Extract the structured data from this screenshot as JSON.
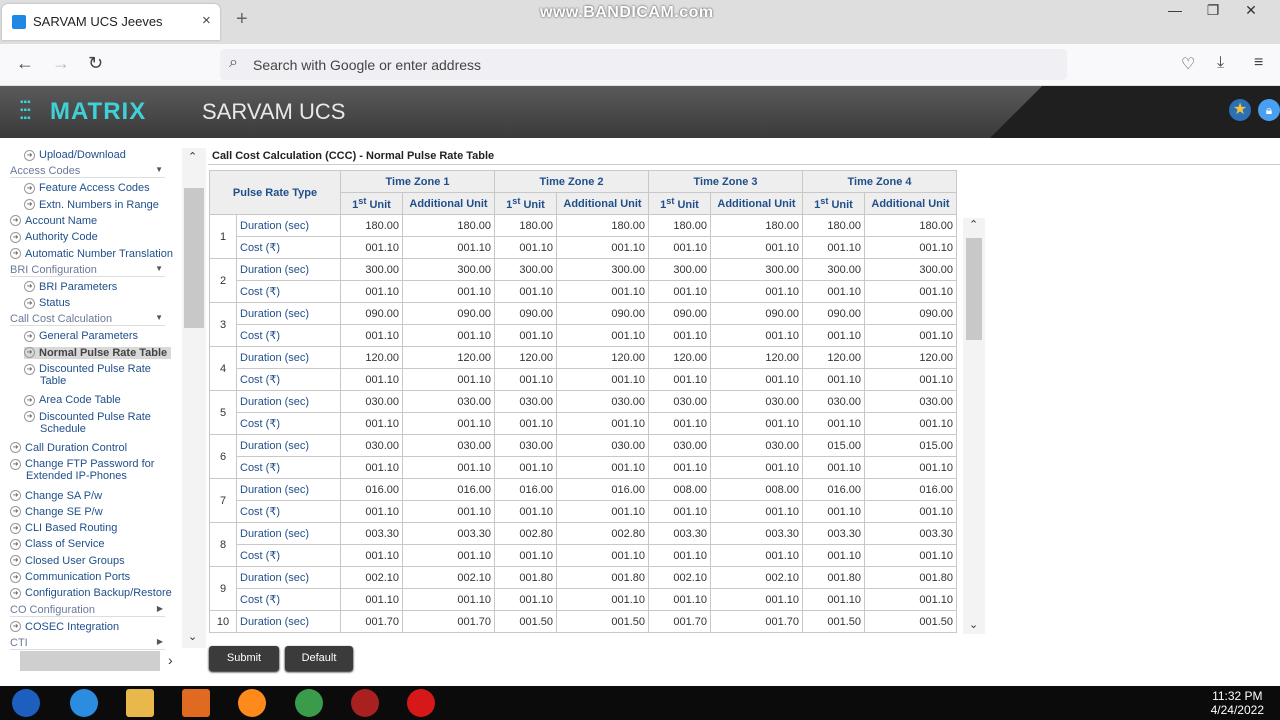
{
  "browser": {
    "tab_title": "SARVAM UCS Jeeves",
    "tab_close": "×",
    "new_tab": "+",
    "watermark": "www.BANDICAM.com",
    "url_placeholder": "Search with Google or enter address",
    "win_min": "—",
    "win_max": "❐",
    "win_close": "✕"
  },
  "app": {
    "logo_text": "MATRIX",
    "title": "SARVAM UCS"
  },
  "sidebar": {
    "items": [
      {
        "label": "Upload/Download",
        "type": "link",
        "indent": 2
      },
      {
        "label": "Access Codes",
        "type": "head"
      },
      {
        "label": "Feature Access Codes",
        "type": "link",
        "indent": 2
      },
      {
        "label": "Extn. Numbers in Range",
        "type": "link",
        "indent": 2
      },
      {
        "label": "Account Name",
        "type": "link",
        "indent": 1
      },
      {
        "label": "Authority Code",
        "type": "link",
        "indent": 1
      },
      {
        "label": "Automatic Number Translation",
        "type": "link",
        "indent": 1
      },
      {
        "label": "BRI Configuration",
        "type": "head"
      },
      {
        "label": "BRI Parameters",
        "type": "link",
        "indent": 2
      },
      {
        "label": "Status",
        "type": "link",
        "indent": 2
      },
      {
        "label": "Call Cost Calculation",
        "type": "head"
      },
      {
        "label": "General Parameters",
        "type": "link",
        "indent": 2
      },
      {
        "label": "Normal Pulse Rate Table",
        "type": "link",
        "indent": 2,
        "active": true
      },
      {
        "label": "Discounted Pulse Rate",
        "label2": "Table",
        "type": "link",
        "indent": 2
      },
      {
        "label": "Area Code Table",
        "type": "link",
        "indent": 2
      },
      {
        "label": "Discounted Pulse Rate",
        "label2": "Schedule",
        "type": "link",
        "indent": 2
      },
      {
        "label": "Call Duration Control",
        "type": "link",
        "indent": 1
      },
      {
        "label": "Change FTP Password for",
        "label2": "Extended IP-Phones",
        "type": "link",
        "indent": 1
      },
      {
        "label": "Change SA P/w",
        "type": "link",
        "indent": 1
      },
      {
        "label": "Change SE P/w",
        "type": "link",
        "indent": 1
      },
      {
        "label": "CLI Based Routing",
        "type": "link",
        "indent": 1
      },
      {
        "label": "Class of Service",
        "type": "link",
        "indent": 1
      },
      {
        "label": "Closed User Groups",
        "type": "link",
        "indent": 1
      },
      {
        "label": "Communication Ports",
        "type": "link",
        "indent": 1
      },
      {
        "label": "Configuration Backup/Restore",
        "type": "link",
        "indent": 1
      },
      {
        "label": "CO Configuration",
        "type": "head-closed"
      },
      {
        "label": "COSEC Integration",
        "type": "link",
        "indent": 1
      },
      {
        "label": "CTI",
        "type": "head-closed"
      }
    ]
  },
  "main": {
    "title": "Call Cost Calculation (CCC) - Normal Pulse Rate Table",
    "col_pulse": "Pulse Rate Type",
    "zones": [
      "Time Zone 1",
      "Time Zone 2",
      "Time Zone 3",
      "Time Zone 4"
    ],
    "unit_first_pre": "1",
    "unit_first_sup": "st",
    "unit_first_post": " Unit",
    "unit_additional": "Additional Unit",
    "label_duration": "Duration (sec)",
    "label_cost": "Cost (₹)",
    "rows": [
      {
        "n": "1",
        "dur": [
          "180.00",
          "180.00",
          "180.00",
          "180.00",
          "180.00",
          "180.00",
          "180.00",
          "180.00"
        ],
        "cost": [
          "001.10",
          "001.10",
          "001.10",
          "001.10",
          "001.10",
          "001.10",
          "001.10",
          "001.10"
        ]
      },
      {
        "n": "2",
        "dur": [
          "300.00",
          "300.00",
          "300.00",
          "300.00",
          "300.00",
          "300.00",
          "300.00",
          "300.00"
        ],
        "cost": [
          "001.10",
          "001.10",
          "001.10",
          "001.10",
          "001.10",
          "001.10",
          "001.10",
          "001.10"
        ]
      },
      {
        "n": "3",
        "dur": [
          "090.00",
          "090.00",
          "090.00",
          "090.00",
          "090.00",
          "090.00",
          "090.00",
          "090.00"
        ],
        "cost": [
          "001.10",
          "001.10",
          "001.10",
          "001.10",
          "001.10",
          "001.10",
          "001.10",
          "001.10"
        ]
      },
      {
        "n": "4",
        "dur": [
          "120.00",
          "120.00",
          "120.00",
          "120.00",
          "120.00",
          "120.00",
          "120.00",
          "120.00"
        ],
        "cost": [
          "001.10",
          "001.10",
          "001.10",
          "001.10",
          "001.10",
          "001.10",
          "001.10",
          "001.10"
        ]
      },
      {
        "n": "5",
        "dur": [
          "030.00",
          "030.00",
          "030.00",
          "030.00",
          "030.00",
          "030.00",
          "030.00",
          "030.00"
        ],
        "cost": [
          "001.10",
          "001.10",
          "001.10",
          "001.10",
          "001.10",
          "001.10",
          "001.10",
          "001.10"
        ]
      },
      {
        "n": "6",
        "dur": [
          "030.00",
          "030.00",
          "030.00",
          "030.00",
          "030.00",
          "030.00",
          "015.00",
          "015.00"
        ],
        "cost": [
          "001.10",
          "001.10",
          "001.10",
          "001.10",
          "001.10",
          "001.10",
          "001.10",
          "001.10"
        ]
      },
      {
        "n": "7",
        "dur": [
          "016.00",
          "016.00",
          "016.00",
          "016.00",
          "008.00",
          "008.00",
          "016.00",
          "016.00"
        ],
        "cost": [
          "001.10",
          "001.10",
          "001.10",
          "001.10",
          "001.10",
          "001.10",
          "001.10",
          "001.10"
        ]
      },
      {
        "n": "8",
        "dur": [
          "003.30",
          "003.30",
          "002.80",
          "002.80",
          "003.30",
          "003.30",
          "003.30",
          "003.30"
        ],
        "cost": [
          "001.10",
          "001.10",
          "001.10",
          "001.10",
          "001.10",
          "001.10",
          "001.10",
          "001.10"
        ]
      },
      {
        "n": "9",
        "dur": [
          "002.10",
          "002.10",
          "001.80",
          "001.80",
          "002.10",
          "002.10",
          "001.80",
          "001.80"
        ],
        "cost": [
          "001.10",
          "001.10",
          "001.10",
          "001.10",
          "001.10",
          "001.10",
          "001.10",
          "001.10"
        ]
      },
      {
        "n": "10",
        "dur": [
          "001.70",
          "001.70",
          "001.50",
          "001.50",
          "001.70",
          "001.70",
          "001.50",
          "001.50"
        ],
        "cost": []
      }
    ],
    "submit_label": "Submit",
    "default_label": "Default"
  },
  "taskbar": {
    "time": "11:32 PM",
    "date": "4/24/2022"
  }
}
